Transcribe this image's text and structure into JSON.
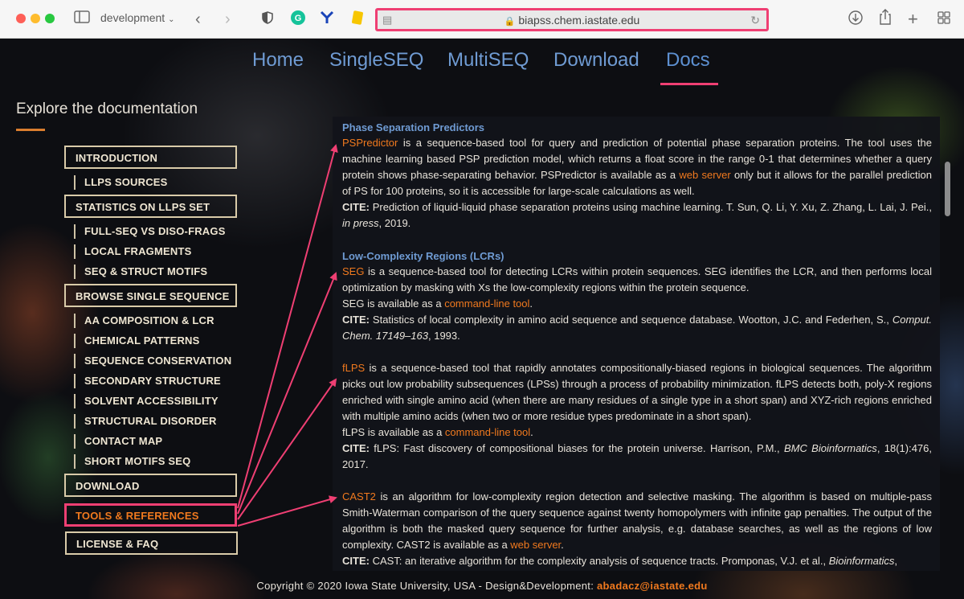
{
  "browser": {
    "tab_group_label": "development",
    "url": "biapss.chem.iastate.edu"
  },
  "nav": {
    "items": [
      "Home",
      "SingleSEQ",
      "MultiSEQ",
      "Download",
      "Docs"
    ],
    "active": "Docs"
  },
  "sidebar": {
    "title": "Explore the documentation",
    "sections": [
      {
        "label": "INTRODUCTION",
        "sub": [
          "LLPS SOURCES"
        ]
      },
      {
        "label": "STATISTICS ON LLPS SET",
        "sub": [
          "FULL-SEQ VS DISO-FRAGS",
          "LOCAL FRAGMENTS",
          "SEQ & STRUCT MOTIFS"
        ]
      },
      {
        "label": "BROWSE SINGLE SEQUENCE",
        "sub": [
          "AA COMPOSITION & LCR",
          "CHEMICAL PATTERNS",
          "SEQUENCE CONSERVATION",
          "SECONDARY STRUCTURE",
          "SOLVENT ACCESSIBILITY",
          "STRUCTURAL DISORDER",
          "CONTACT MAP",
          "SHORT MOTIFS SEQ"
        ]
      },
      {
        "label": "DOWNLOAD",
        "sub": []
      },
      {
        "label": "TOOLS & REFERENCES",
        "sub": [],
        "active": true
      },
      {
        "label": "LICENSE & FAQ",
        "sub": []
      }
    ]
  },
  "content": {
    "section1_title": "Phase Separation Predictors",
    "pspredictor": {
      "name": "PSPredictor",
      "text1": " is a sequence-based tool for query and prediction of potential phase separation proteins. The tool uses the machine learning based PSP prediction model, which returns a float score in the range 0-1 that determines whether a query protein shows phase-separating behavior. PSPredictor is available as a ",
      "link": "web server",
      "text2": " only but it allows for the parallel prediction of PS for 100 proteins, so it is accessible for large-scale calculations as well.",
      "cite_label": "CITE:",
      "cite": " Prediction of liquid-liquid phase separation proteins using machine learning. T. Sun, Q. Li, Y. Xu, Z. Zhang, L. Lai, J. Pei., ",
      "cite_em": "in press",
      "cite_end": ", 2019."
    },
    "section2_title": "Low-Complexity Regions (LCRs)",
    "seg": {
      "name": "SEG",
      "text1": " is a sequence-based tool for detecting LCRs within protein sequences. SEG identifies the LCR, and then performs local optimization by masking with Xs the low-complexity regions within the protein sequence.",
      "avail": "SEG is available as a ",
      "link": "command-line tool",
      "avail_end": ".",
      "cite_label": "CITE:",
      "cite": " Statistics of local complexity in amino acid sequence and sequence database. Wootton, J.C. and Federhen, S., ",
      "cite_em": "Comput. Chem. 17149–163",
      "cite_end": ", 1993."
    },
    "flps": {
      "name": "fLPS",
      "text1": " is a sequence-based tool that rapidly annotates compositionally-biased regions in biological sequences. The algorithm picks out low probability subsequences (LPSs) through a process of probability minimization. fLPS detects both, poly-X regions enriched with single amino acid (when there are many residues of a single type in a short span) and XYZ-rich regions enriched with multiple amino acids (when two or more residue types predominate in a short span).",
      "avail": "fLPS is available as a ",
      "link": "command-line tool",
      "avail_end": ".",
      "cite_label": "CITE:",
      "cite": " fLPS: Fast discovery of compositional biases for the protein universe. Harrison, P.M., ",
      "cite_em": "BMC Bioinformatics",
      "cite_end": ", 18(1):476, 2017."
    },
    "cast2": {
      "name": "CAST2",
      "text1": " is an algorithm for low-complexity region detection and selective masking. The algorithm is based on multiple-pass Smith-Waterman comparison of the query sequence against twenty homopolymers with infinite gap penalties. The output of the algorithm is both the masked query sequence for further analysis, e.g. database searches, as well as the regions of low complexity. CAST2 is available as a ",
      "link": "web server",
      "text2": ".",
      "cite_label": "CITE:",
      "cite": " CAST: an iterative algorithm for the complexity analysis of sequence tracts. Promponas, V.J. et al., ",
      "cite_em": "Bioinformatics",
      "cite_end": ","
    }
  },
  "footer": {
    "text": "Copyright © 2020 Iowa State University, USA - Design&Development: ",
    "email": "abadacz@iastate.edu"
  },
  "colors": {
    "highlight": "#ef3f73",
    "link": "#f0791e",
    "nav": "#6f9bd3"
  }
}
